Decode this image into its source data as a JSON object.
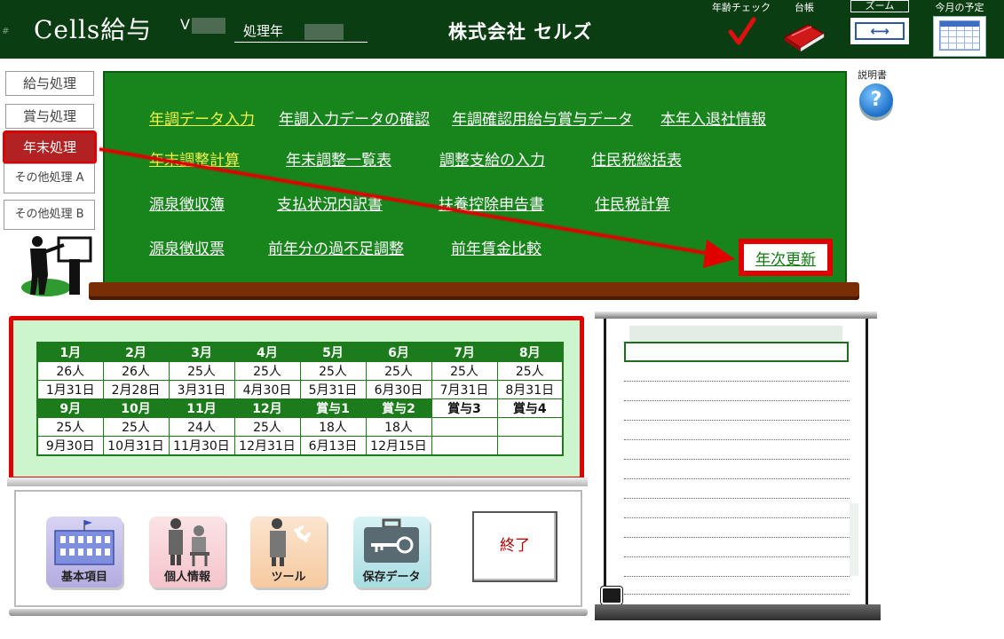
{
  "header": {
    "hash": "#",
    "app_title": "Cells給与",
    "version_prefix": "V",
    "year_label": "処理年",
    "company": "株式会社 セルズ",
    "tools": {
      "age_check": "年齢チェック",
      "ledger": "台帳",
      "zoom": "ズーム",
      "schedule": "今月の予定"
    }
  },
  "sidebar": {
    "items": [
      {
        "label": "給与処理"
      },
      {
        "label": "賞与処理"
      },
      {
        "label": "年末処理"
      },
      {
        "label": "その他処理 A"
      },
      {
        "label": "その他処理 B"
      }
    ]
  },
  "board": {
    "row1": [
      "年調データ入力",
      "年調入力データの確認",
      "年調確認用給与賞与データ",
      "本年入退社情報"
    ],
    "row2": [
      "年末調整計算",
      "年末調整一覧表",
      "調整支給の入力",
      "住民税総括表"
    ],
    "row3": [
      "源泉徴収簿",
      "支払状況内訳書",
      "扶養控除申告書",
      "住民税計算"
    ],
    "row4": [
      "源泉徴収票",
      "前年分の過不足調整",
      "前年賃金比較"
    ],
    "update": "年次更新"
  },
  "help": {
    "label": "説明書",
    "icon": "?"
  },
  "calendar": {
    "row1_headers": [
      "1月",
      "2月",
      "3月",
      "4月",
      "5月",
      "6月",
      "7月",
      "8月"
    ],
    "row1_counts": [
      "26人",
      "26人",
      "25人",
      "25人",
      "25人",
      "25人",
      "25人",
      "25人"
    ],
    "row1_dates": [
      "1月31日",
      "2月28日",
      "3月31日",
      "4月30日",
      "5月31日",
      "6月30日",
      "7月31日",
      "8月31日"
    ],
    "row2_headers": [
      "9月",
      "10月",
      "11月",
      "12月",
      "賞与1",
      "賞与2",
      "賞与3",
      "賞与4"
    ],
    "row2_counts": [
      "25人",
      "25人",
      "24人",
      "25人",
      "18人",
      "18人",
      "",
      ""
    ],
    "row2_dates": [
      "9月30日",
      "10月31日",
      "11月30日",
      "12月31日",
      "6月13日",
      "12月15日",
      "",
      ""
    ]
  },
  "bottom_buttons": {
    "basic": "基本項目",
    "personal": "個人情報",
    "tool": "ツール",
    "save": "保存データ",
    "exit": "終了"
  },
  "colors": {
    "header_bg": "#0b3d12",
    "board_green": "#18841c",
    "highlight_red": "#e00000",
    "link_yellow": "#f5f54a"
  }
}
